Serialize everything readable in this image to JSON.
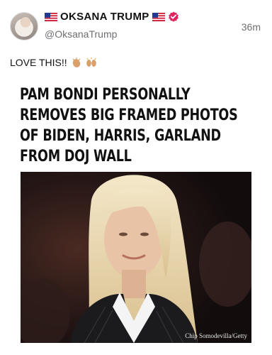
{
  "post": {
    "display_name": "OKSANA TRUMP",
    "handle": "@OksanaTrump",
    "timestamp": "36m",
    "text": "LOVE THIS!!",
    "emojis": [
      "clapping-hands-icon",
      "raising-hands-icon"
    ]
  },
  "article": {
    "headline_lines": [
      "PAM BONDI PERSONALLY",
      "REMOVES BIG FRAMED PHOTOS",
      "OF BIDEN, HARRIS, GARLAND",
      "FROM DOJ WALL"
    ],
    "photo_credit": "Chip Somodevilla/Getty"
  },
  "colors": {
    "verified": "#e0245e",
    "flag_red": "#c8102e",
    "flag_blue": "#1f3a93",
    "secondary_text": "#6e6e73"
  }
}
